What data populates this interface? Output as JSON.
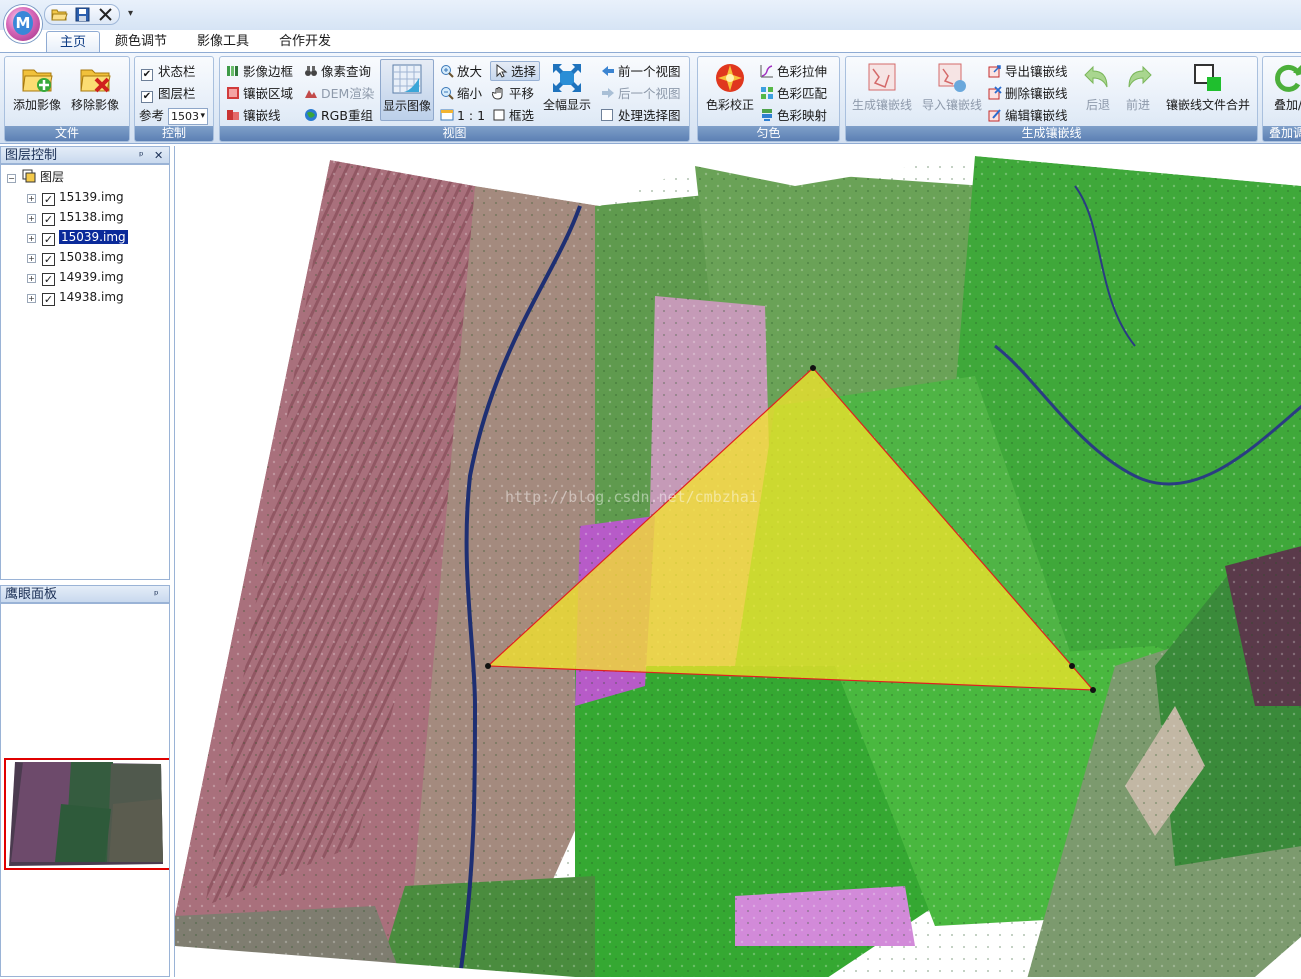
{
  "app": {
    "orb_letter": "M"
  },
  "quick_access": {
    "open_icon": "folder-open-icon",
    "save_icon": "save-icon",
    "close_icon": "close-icon",
    "menu_glyph": "▾"
  },
  "tabs": [
    {
      "label": "主页",
      "active": true
    },
    {
      "label": "颜色调节",
      "active": false
    },
    {
      "label": "影像工具",
      "active": false
    },
    {
      "label": "合作开发",
      "active": false
    }
  ],
  "ribbon": {
    "file": {
      "group_label": "文件",
      "add_image": "添加影像",
      "remove_image": "移除影像"
    },
    "control": {
      "group_label": "控制",
      "status_bar": "状态栏",
      "status_bar_checked": true,
      "layer_bar": "图层栏",
      "layer_bar_checked": true,
      "reference_label": "参考",
      "reference_value": "1503"
    },
    "view": {
      "group_label": "视图",
      "image_border": "影像边框",
      "pixel_query": "像素查询",
      "mosaic_area": "镶嵌区域",
      "dem_render": "DEM渲染",
      "mosaic_line": "镶嵌线",
      "rgb_recombine": "RGB重组",
      "show_image": "显示图像",
      "zoom_in": "放大",
      "select": "选择",
      "zoom_out": "缩小",
      "pan": "平移",
      "one_to_one": "1 : 1",
      "box_select": "框选",
      "full_extent": "全幅显示",
      "prev_view": "前一个视图",
      "next_view": "后一个视图",
      "process_selected": "处理选择图"
    },
    "color": {
      "group_label": "匀色",
      "color_correct": "色彩校正",
      "color_stretch": "色彩拉伸",
      "color_match": "色彩匹配",
      "color_map": "色彩映射"
    },
    "seamline": {
      "group_label": "生成镶嵌线",
      "generate": "生成镶嵌线",
      "import": "导入镶嵌线",
      "export": "导出镶嵌线",
      "delete": "删除镶嵌线",
      "edit": "编辑镶嵌线",
      "back": "后退",
      "forward": "前进",
      "merge_files": "镶嵌线文件合并"
    },
    "overlay": {
      "group_label": "叠加调",
      "overlay_btn": "叠加/"
    }
  },
  "layer_panel": {
    "title": "图层控制",
    "pin_glyph": "ᵖ",
    "close_glyph": "✕",
    "root_label": "图层",
    "layers": [
      {
        "name": "15139.img",
        "checked": true,
        "selected": false
      },
      {
        "name": "15138.img",
        "checked": true,
        "selected": false
      },
      {
        "name": "15039.img",
        "checked": true,
        "selected": true
      },
      {
        "name": "15038.img",
        "checked": true,
        "selected": false
      },
      {
        "name": "14939.img",
        "checked": true,
        "selected": false
      },
      {
        "name": "14938.img",
        "checked": true,
        "selected": false
      }
    ]
  },
  "overview_panel": {
    "title": "鹰眼面板",
    "pin_glyph": "ᵖ"
  },
  "map": {
    "watermark": "http://blog.csdn.net/cmbzhai",
    "polygon_fill": "#f5e52a",
    "polygon_stroke": "#e02020"
  },
  "colors": {
    "accent": "#5c80b4",
    "selection": "#0a2a9a",
    "vegetation": "#3fbf3a",
    "terrain": "#a96b78",
    "overview_border": "#e00000"
  }
}
